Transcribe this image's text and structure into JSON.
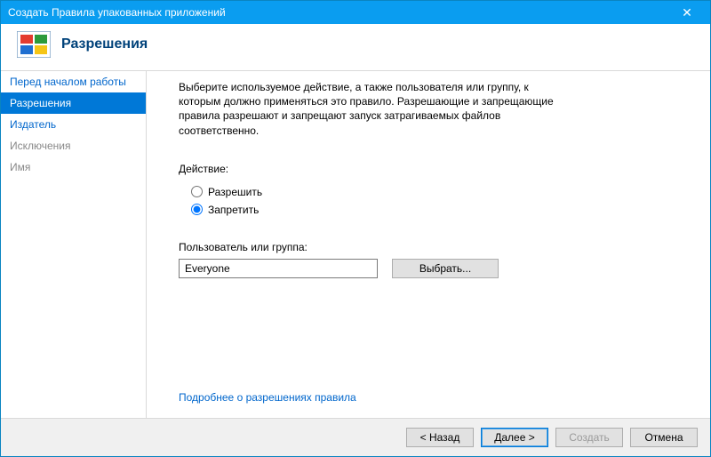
{
  "titlebar": {
    "title": "Создать Правила упакованных приложений"
  },
  "header": {
    "heading": "Разрешения"
  },
  "sidebar": {
    "steps": [
      {
        "label": "Перед началом работы",
        "state": "available"
      },
      {
        "label": "Разрешения",
        "state": "current"
      },
      {
        "label": "Издатель",
        "state": "available"
      },
      {
        "label": "Исключения",
        "state": "disabled"
      },
      {
        "label": "Имя",
        "state": "disabled"
      }
    ]
  },
  "content": {
    "description": "Выберите используемое действие, а также пользователя или группу, к которым должно применяться это правило. Разрешающие и запрещающие правила разрешают и запрещают запуск затрагиваемых файлов соответственно.",
    "action_label": "Действие:",
    "radios": {
      "allow": "Разрешить",
      "deny": "Запретить",
      "selected": "deny"
    },
    "user_label": "Пользователь или группа:",
    "user_value": "Everyone",
    "browse_label": "Выбрать...",
    "help_link": "Подробнее о разрешениях правила"
  },
  "footer": {
    "back": "< Назад",
    "next": "Далее >",
    "create": "Создать",
    "cancel": "Отмена"
  }
}
